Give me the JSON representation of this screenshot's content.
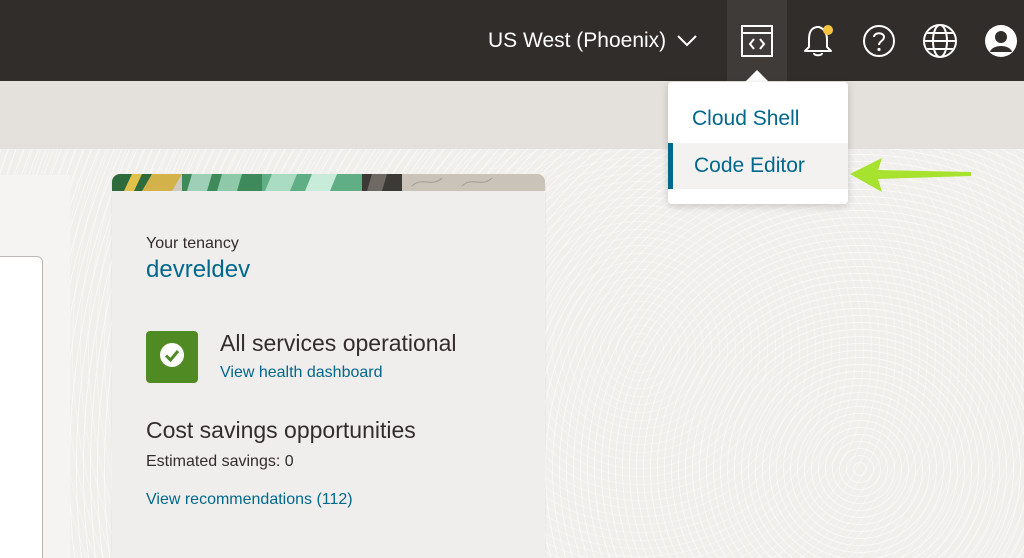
{
  "header": {
    "region_label": "US West (Phoenix)",
    "icons": {
      "developer_tools": "code-editor-icon",
      "notifications": "bell-icon",
      "help": "help-icon",
      "language": "globe-icon",
      "profile": "user-icon"
    },
    "notification_dot_color": "#f5c542"
  },
  "dev_tools_menu": {
    "items": [
      {
        "label": "Cloud Shell",
        "selected": false
      },
      {
        "label": "Code Editor",
        "selected": true
      }
    ]
  },
  "tenancy_card": {
    "tenancy_label": "Your tenancy",
    "tenancy_name": "devreldev",
    "status_title": "All services operational",
    "health_link": "View health dashboard",
    "cost_title": "Cost savings opportunities",
    "cost_estimate": "Estimated savings: 0",
    "recommendations_link": "View recommendations (112)"
  },
  "colors": {
    "topbar": "#312d2a",
    "link": "#00688c",
    "status_ok": "#508a22",
    "annotation_arrow": "#a6e22e"
  }
}
